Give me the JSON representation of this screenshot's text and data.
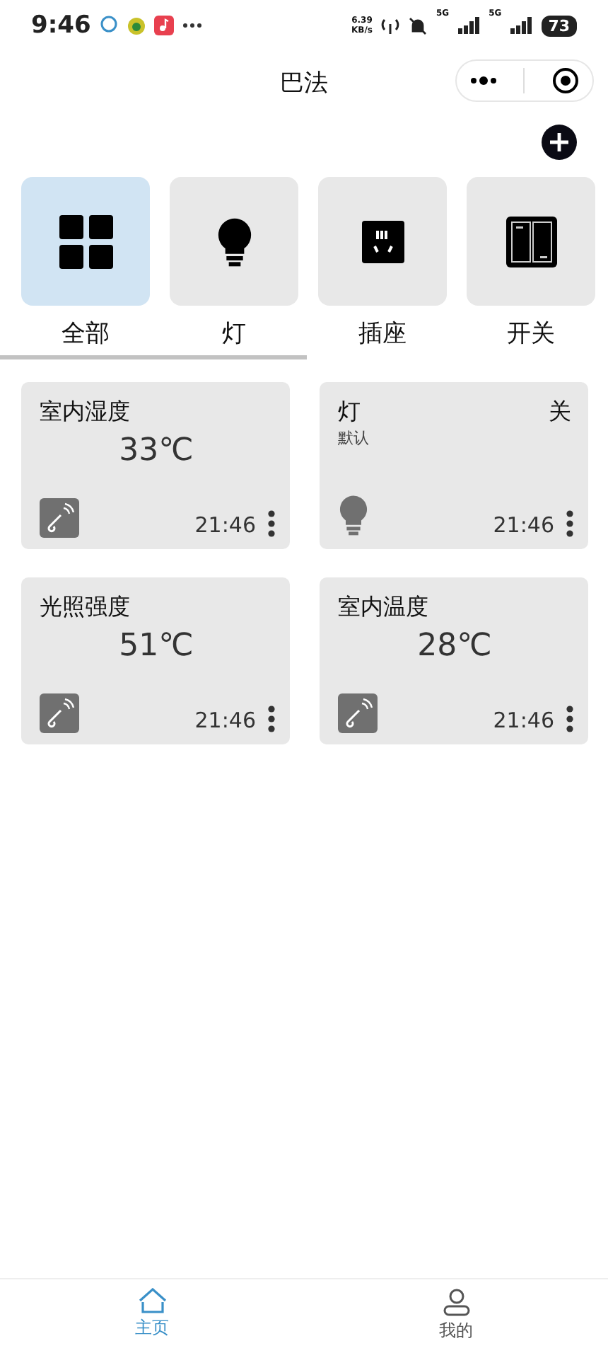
{
  "status_bar": {
    "time": "9:46",
    "net_speed": "6.39",
    "net_unit": "KB/s",
    "sim_labels": [
      "5G",
      "5G"
    ],
    "battery": "73"
  },
  "title_bar": {
    "title": "巴法"
  },
  "categories": [
    {
      "kind": "all",
      "label": "全部",
      "selected": true
    },
    {
      "kind": "light",
      "label": "灯",
      "selected": false
    },
    {
      "kind": "socket",
      "label": "插座",
      "selected": false
    },
    {
      "kind": "switch",
      "label": "开关",
      "selected": false
    }
  ],
  "devices": [
    {
      "kind": "sensor",
      "name": "室内湿度",
      "value": "33℃",
      "time": "21:46"
    },
    {
      "kind": "light",
      "name": "灯",
      "state": "关",
      "group": "默认",
      "time": "21:46"
    },
    {
      "kind": "sensor",
      "name": "光照强度",
      "value": "51℃",
      "time": "21:46"
    },
    {
      "kind": "sensor",
      "name": "室内温度",
      "value": "28℃",
      "time": "21:46"
    }
  ],
  "tab_bar": [
    {
      "kind": "home",
      "label": "主页",
      "selected": true
    },
    {
      "kind": "user",
      "label": "我的",
      "selected": false
    }
  ]
}
